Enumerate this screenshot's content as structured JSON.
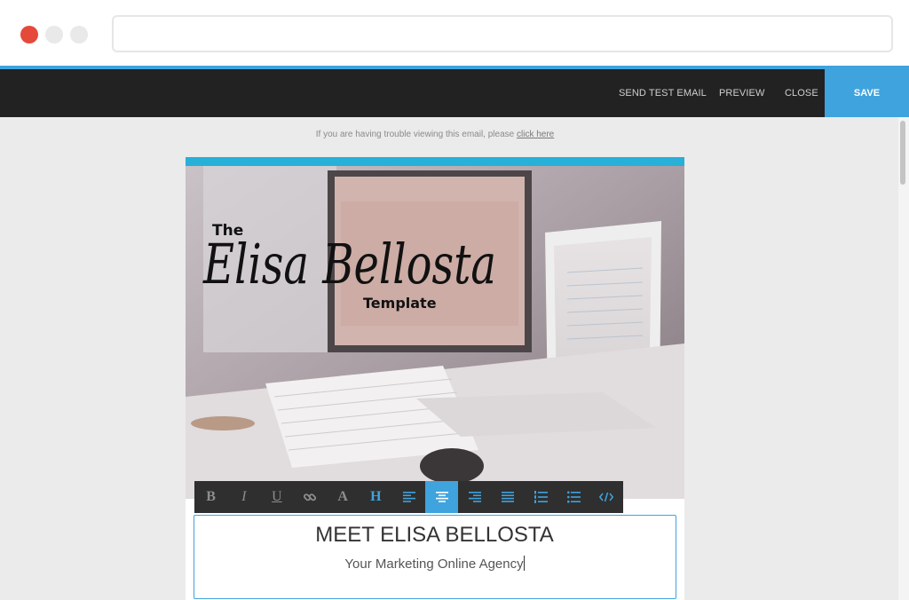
{
  "topbar": {
    "send_test_email": "SEND TEST EMAIL",
    "preview": "PREVIEW",
    "close": "CLOSE",
    "save": "SAVE"
  },
  "email": {
    "trouble_text": "If you are having trouble viewing this email, please",
    "trouble_link": "click here",
    "hero": {
      "the": "The",
      "script_name": "Elisa Bellosta",
      "template": "Template"
    },
    "heading": "MEET ELISA BELLOSTA",
    "subheading": "Your Marketing Online Agency"
  },
  "format_toolbar": [
    {
      "name": "bold-button",
      "icon": "bold-icon"
    },
    {
      "name": "italic-button",
      "icon": "italic-icon"
    },
    {
      "name": "underline-button",
      "icon": "underline-icon"
    },
    {
      "name": "link-button",
      "icon": "link-icon"
    },
    {
      "name": "font-color-button",
      "icon": "font-color-icon"
    },
    {
      "name": "heading-button",
      "icon": "heading-icon"
    },
    {
      "name": "align-left-button",
      "icon": "align-left-icon"
    },
    {
      "name": "align-center-button",
      "icon": "align-center-icon",
      "active": true
    },
    {
      "name": "align-right-button",
      "icon": "align-right-icon"
    },
    {
      "name": "justify-button",
      "icon": "justify-icon"
    },
    {
      "name": "ordered-list-button",
      "icon": "ordered-list-icon"
    },
    {
      "name": "unordered-list-button",
      "icon": "unordered-list-icon"
    },
    {
      "name": "source-code-button",
      "icon": "code-icon"
    }
  ],
  "colors": {
    "accent": "#3fa3de",
    "toolbar": "#222222",
    "email_top_bar": "#27b0d8",
    "close_dot": "#e5493a"
  }
}
